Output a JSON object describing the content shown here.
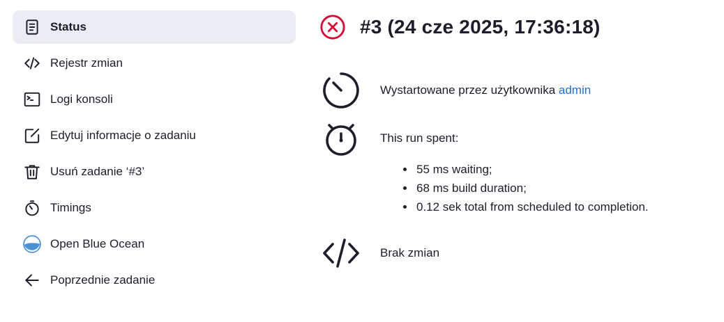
{
  "sidebar": {
    "items": [
      {
        "label": "Status",
        "icon": "document-icon",
        "active": true
      },
      {
        "label": "Rejestr zmian",
        "icon": "code-icon"
      },
      {
        "label": "Logi konsoli",
        "icon": "terminal-icon"
      },
      {
        "label": "Edytuj informacje o zadaniu",
        "icon": "edit-icon"
      },
      {
        "label": "Usuń zadanie ‘#3’",
        "icon": "trash-icon"
      },
      {
        "label": "Timings",
        "icon": "stopwatch-icon"
      },
      {
        "label": "Open Blue Ocean",
        "icon": "blue-ocean-icon"
      },
      {
        "label": "Poprzednie zadanie",
        "icon": "arrow-left-icon"
      }
    ]
  },
  "build": {
    "title": "#3 (24 cze 2025, 17:36:18)",
    "status_icon": "failed-icon",
    "status_color": "#d10d35",
    "started_by_text": "Wystartowane przez użytkownika ",
    "started_by_user": "admin",
    "run_spent_label": "This run spent:",
    "run_stats": [
      "55 ms waiting;",
      "68 ms build duration;",
      "0.12 sek total from scheduled to completion."
    ],
    "changes_text": "Brak zmian"
  },
  "colors": {
    "active_bg": "#ebecf4",
    "link": "#1f6fd1",
    "text": "#1d1d2b",
    "ocean_blue": "#4a90d9"
  }
}
